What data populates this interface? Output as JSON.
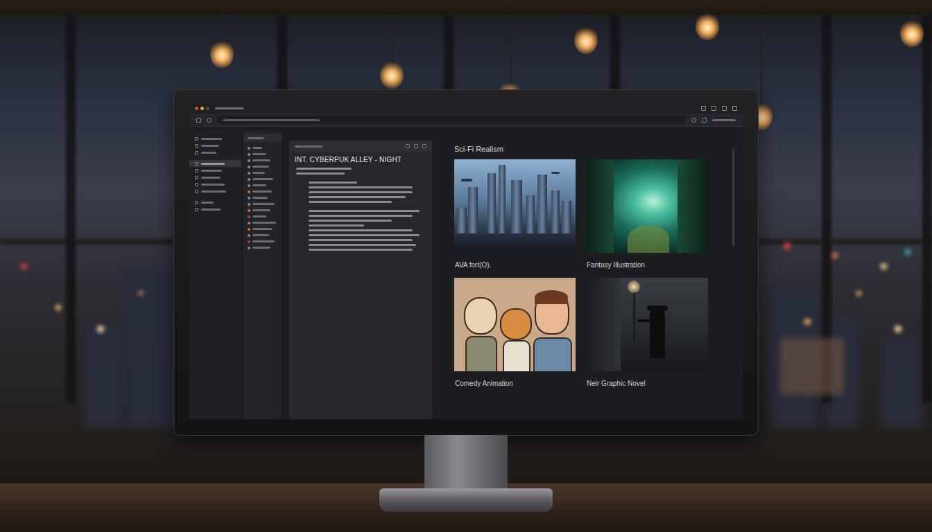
{
  "sidebar": {
    "items": [
      {
        "selected": false
      },
      {
        "selected": false
      },
      {
        "selected": false
      },
      {
        "selected": true
      },
      {
        "selected": false
      },
      {
        "selected": false
      },
      {
        "selected": false
      },
      {
        "selected": false
      },
      {
        "selected": false
      },
      {
        "selected": false
      }
    ]
  },
  "files": {
    "items": [
      {
        "color": "#8a8c92"
      },
      {
        "color": "#8a8c92"
      },
      {
        "color": "#8a8c92"
      },
      {
        "color": "#8a8c92"
      },
      {
        "color": "#8a8c92"
      },
      {
        "color": "#8a8c92"
      },
      {
        "color": "#8a8c92"
      },
      {
        "color": "#d0782c"
      },
      {
        "color": "#8a8c92"
      },
      {
        "color": "#8a8c92"
      },
      {
        "color": "#d0782c"
      },
      {
        "color": "#c0392b"
      },
      {
        "color": "#8a8c92"
      },
      {
        "color": "#d0782c"
      },
      {
        "color": "#8a8c92"
      },
      {
        "color": "#c0392b"
      },
      {
        "color": "#8a8c92"
      }
    ]
  },
  "editor": {
    "heading": "INT. CYBERPUK ALLEY - NIGHT"
  },
  "gallery": {
    "title": "Sci-Fi Realism",
    "cards": [
      {
        "caption": "AVA fort(O).",
        "kind": "city"
      },
      {
        "caption": "Fantasy Illustration",
        "kind": "forest"
      },
      {
        "caption": "Comedy Animation",
        "kind": "cartoon"
      },
      {
        "caption": "Neir Graphic Novel",
        "kind": "noir"
      }
    ]
  }
}
